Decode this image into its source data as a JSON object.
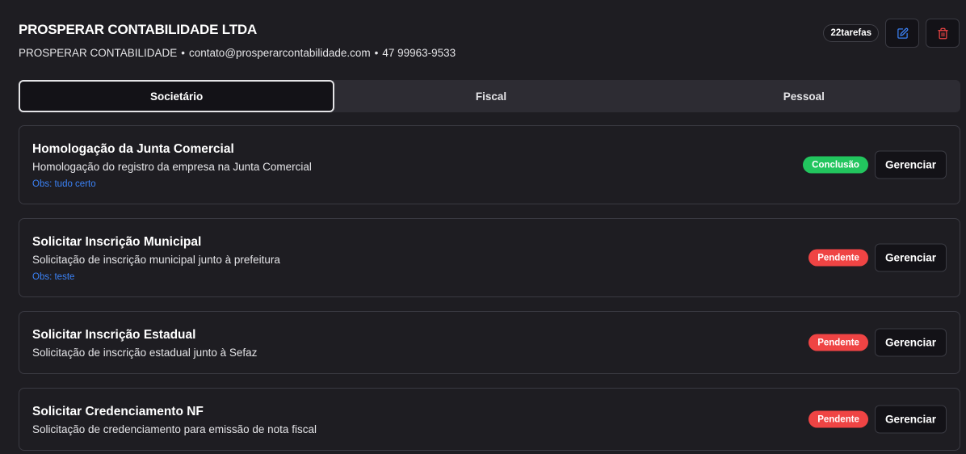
{
  "company": {
    "name": "PROSPERAR CONTABILIDADE LTDA",
    "trade_name": "PROSPERAR CONTABILIDADE",
    "separator": "•",
    "email": "contato@prosperarcontabilidade.com",
    "phone": "47 99963-9533"
  },
  "header": {
    "task_count": "22tarefas",
    "edit_icon": "edit-icon",
    "delete_icon": "trash-icon",
    "edit_color": "#3b82f6",
    "delete_color": "#ef4444"
  },
  "tabs": [
    {
      "label": "Societário",
      "active": true
    },
    {
      "label": "Fiscal",
      "active": false
    },
    {
      "label": "Pessoal",
      "active": false
    }
  ],
  "tasks": [
    {
      "title": "Homologação da Junta Comercial",
      "description": "Homologação do registro da empresa na Junta Comercial",
      "obs": "Obs: tudo certo",
      "status": "Conclusão",
      "status_color": "#22c55e",
      "action": "Gerenciar"
    },
    {
      "title": "Solicitar Inscrição Municipal",
      "description": "Solicitação de inscrição municipal junto à prefeitura",
      "obs": "Obs: teste",
      "status": "Pendente",
      "status_color": "#ef4444",
      "action": "Gerenciar"
    },
    {
      "title": "Solicitar Inscrição Estadual",
      "description": "Solicitação de inscrição estadual junto à Sefaz",
      "status": "Pendente",
      "status_color": "#ef4444",
      "action": "Gerenciar"
    },
    {
      "title": "Solicitar Credenciamento NF",
      "description": "Solicitação de credenciamento para emissão de nota fiscal",
      "status": "Pendente",
      "status_color": "#ef4444",
      "action": "Gerenciar"
    }
  ]
}
